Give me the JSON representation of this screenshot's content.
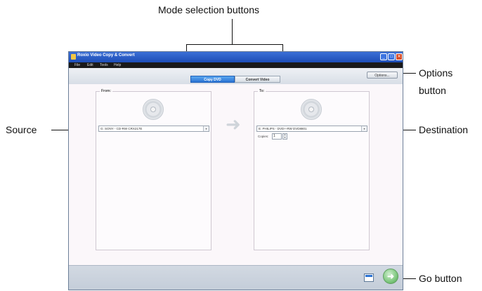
{
  "annotations": {
    "mode_selection": "Mode selection buttons",
    "options_line1": "Options",
    "options_line2": "button",
    "source": "Source",
    "destination": "Destination",
    "go": "Go button"
  },
  "window": {
    "title": "Roxio Video Copy & Convert",
    "controls": {
      "minimize": "_",
      "maximize": "□",
      "close": "✕"
    }
  },
  "menu": [
    "File",
    "Edit",
    "Tools",
    "Help"
  ],
  "tabs": {
    "copy_dvd": "Copy DVD",
    "convert_video": "Convert Video",
    "active": "Copy DVD"
  },
  "options_button": "Options...",
  "from_panel": {
    "title": "From:",
    "drive": "G: SONY - CD-RW  CRX217E"
  },
  "to_panel": {
    "title": "To:",
    "drive": "E: PHILIPS - DVD+-RW DVD8801",
    "copies_label": "Copies:",
    "copies_value": "1"
  },
  "icons": {
    "arrow": "arrow-right-icon",
    "dropdown": "chevron-down-icon",
    "go": "go-icon",
    "media": "media-icon"
  },
  "colors": {
    "title_bar": "#2b5fc9",
    "active_tab": "#2b73d3",
    "go_button": "#7fc87f",
    "close_button": "#d9502b"
  }
}
